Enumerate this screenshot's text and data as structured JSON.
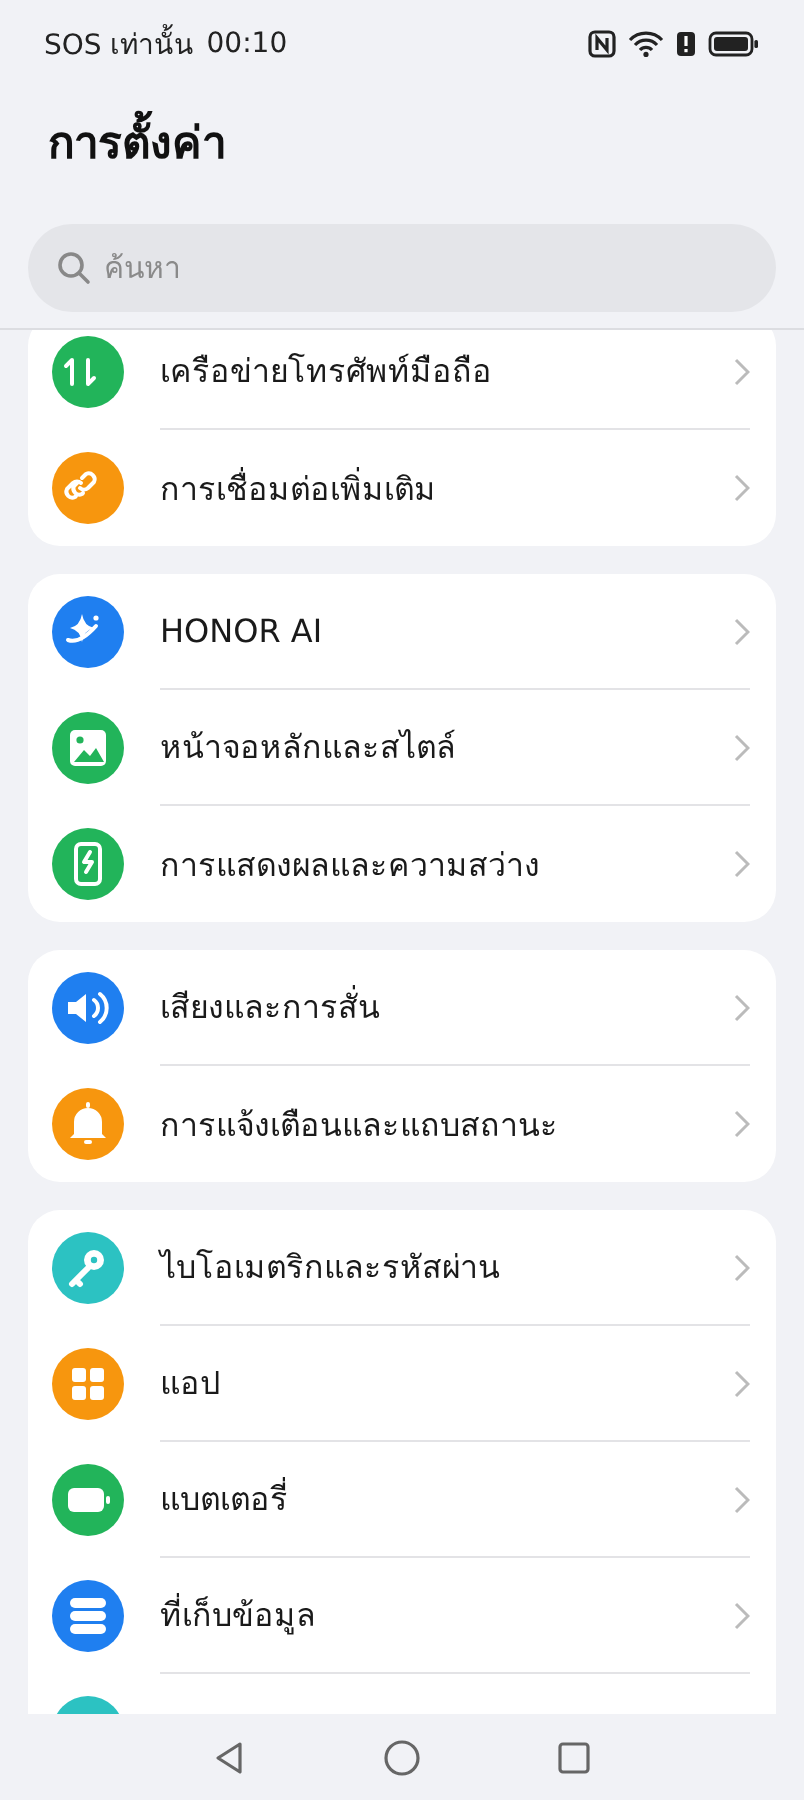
{
  "status_bar": {
    "carrier": "SOS เท่านั้น",
    "time": "00:10"
  },
  "title": "การตั้งค่า",
  "search": {
    "placeholder": "ค้นหา"
  },
  "groups": [
    {
      "items": [
        {
          "label": "เครือข่ายโทรศัพท์มือถือ",
          "color": "#22b45a"
        },
        {
          "label": "การเชื่อมต่อเพิ่มเติม",
          "color": "#f7960e"
        }
      ]
    },
    {
      "items": [
        {
          "label": "HONOR AI",
          "color": "#1f7ff0"
        },
        {
          "label": "หน้าจอหลักและสไตล์",
          "color": "#22b45a"
        },
        {
          "label": "การแสดงผลและความสว่าง",
          "color": "#22b45a"
        }
      ]
    },
    {
      "items": [
        {
          "label": "เสียงและการสั่น",
          "color": "#1f7ff0"
        },
        {
          "label": "การแจ้งเตือนและแถบสถานะ",
          "color": "#f7960e"
        }
      ]
    },
    {
      "items": [
        {
          "label": "ไบโอเมตริกและรหัสผ่าน",
          "color": "#2cc2c2"
        },
        {
          "label": "แอป",
          "color": "#f7960e"
        },
        {
          "label": "แบตเตอรี่",
          "color": "#22b45a"
        },
        {
          "label": "ที่เก็บข้อมูล",
          "color": "#1f7ff0"
        },
        {
          "color": "#2cc2c2"
        }
      ]
    }
  ]
}
